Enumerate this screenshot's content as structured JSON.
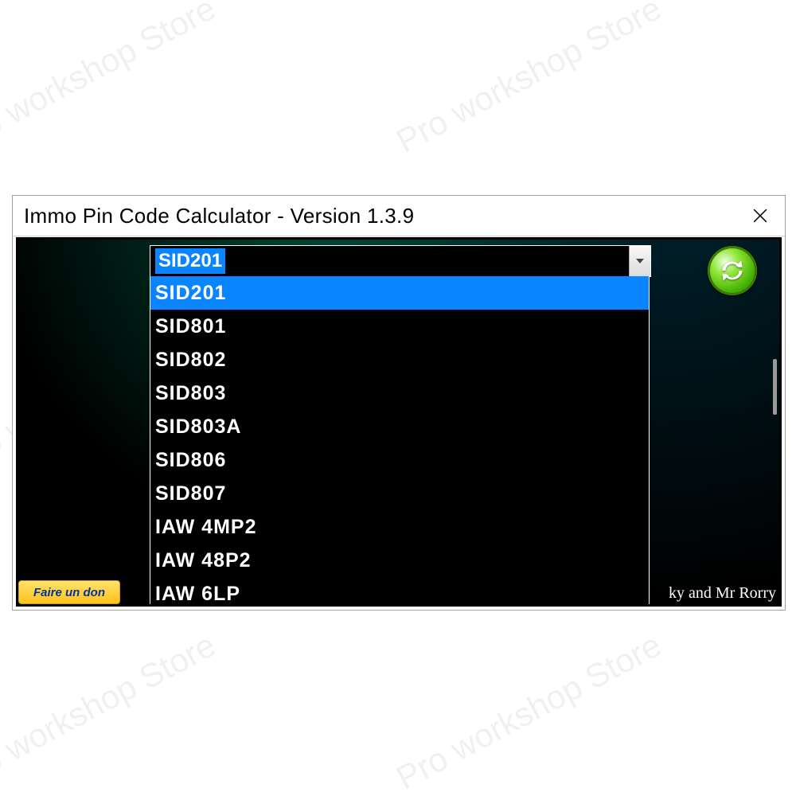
{
  "watermark": "Pro workshop Store",
  "window": {
    "title": "Immo Pin Code Calculator  -  Version 1.3.9"
  },
  "combo": {
    "selected": "SID201",
    "options": [
      "SID201",
      "SID801",
      "SID802",
      "SID803",
      "SID803A",
      "SID806",
      "SID807",
      "IAW 4MP2",
      "IAW 48P2",
      "IAW 6LP"
    ],
    "highlighted_index": 0
  },
  "donate_label": "Faire un don",
  "credits": "ky and Mr Rorry",
  "icons": {
    "close": "close-icon",
    "refresh": "refresh-icon",
    "chevron_down": "chevron-down-icon"
  }
}
